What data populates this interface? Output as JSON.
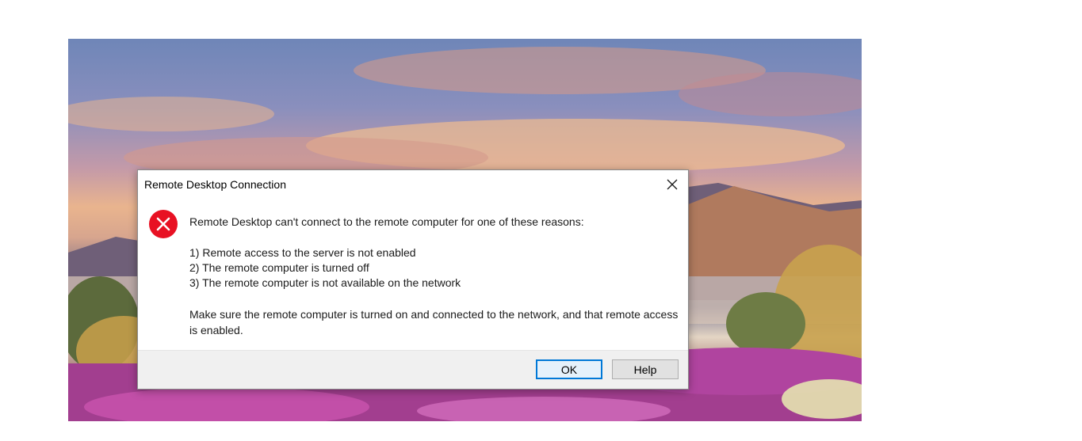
{
  "dialog": {
    "title": "Remote Desktop Connection",
    "close_icon": "close-icon",
    "error_icon": "error-icon",
    "message": "Remote Desktop can't connect to the remote computer for one of these reasons:",
    "reasons": [
      "1) Remote access to the server is not enabled",
      "2) The remote computer is turned off",
      "3) The remote computer is not available on the network"
    ],
    "advice": "Make sure the remote computer is turned on and connected to the network, and that remote access is enabled.",
    "buttons": {
      "ok_label": "OK",
      "help_label": "Help"
    }
  },
  "colors": {
    "error_red": "#e81123",
    "focus_blue": "#0078d7",
    "button_bar": "#f0f0f0"
  }
}
